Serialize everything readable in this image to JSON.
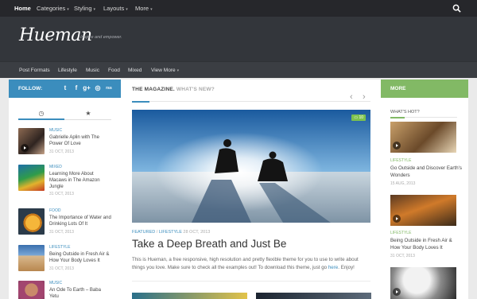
{
  "topnav": {
    "items": [
      {
        "label": "Home"
      },
      {
        "label": "Categories",
        "caret": "▾"
      },
      {
        "label": "Styling",
        "caret": "▾"
      },
      {
        "label": "Layouts",
        "caret": "▾"
      },
      {
        "label": "More",
        "caret": "▾"
      }
    ]
  },
  "header": {
    "logo": "Hueman",
    "tagline": "Inspire and empower."
  },
  "subnav": {
    "items": [
      {
        "label": "Post Formats"
      },
      {
        "label": "Lifestyle"
      },
      {
        "label": "Music"
      },
      {
        "label": "Food"
      },
      {
        "label": "Mixed"
      },
      {
        "label": "View More",
        "caret": "▾"
      }
    ]
  },
  "left": {
    "follow_label": "FOLLOW:",
    "social": [
      "t",
      "f",
      "g+",
      "◎",
      "rss"
    ],
    "tabs": [
      "◷",
      "★"
    ],
    "items": [
      {
        "cat": "MUSIC",
        "title": "Gabrielle Aplin with The Power Of Love",
        "date": "31 OCT, 2013"
      },
      {
        "cat": "MIXED",
        "title": "Learning More About Macaws in The Amazon Jungle",
        "date": "31 OCT, 2013"
      },
      {
        "cat": "FOOD",
        "title": "The Importance of Water and Drinking Lots Of It",
        "date": "31 OCT, 2013"
      },
      {
        "cat": "LIFESTYLE",
        "title": "Being Outside in Fresh Air & How Your Body Loves It",
        "date": "31 OCT, 2013"
      },
      {
        "cat": "MUSIC",
        "title": "An Ode To Earth – Baba Yetu",
        "date": ""
      }
    ]
  },
  "main": {
    "section_title": "THE MAGAZINE.",
    "section_sub": "WHAT'S NEW?",
    "comment_badge": "10",
    "post": {
      "cat1": "FEATURED",
      "sep": " / ",
      "cat2": "LIFESTYLE",
      "date": "28 OCT, 2013",
      "title": "Take a Deep Breath and Just Be",
      "excerpt_a": "This is Hueman, a free responsive, high resolution and pretty flexible theme for you to use to write about things you love. Make sure to check all the examples out! To download this theme, just go",
      "excerpt_link": "here",
      "excerpt_b": ". Enjoy!"
    }
  },
  "right": {
    "more_label": "MORE",
    "hot_label": "WHAT'S HOT?",
    "items": [
      {
        "cat": "LIFESTYLE",
        "title": "Go Outside and Discover Earth's Wonders",
        "date": "15 AUG, 2013"
      },
      {
        "cat": "LIFESTYLE",
        "title": "Being Outside in Fresh Air & How Your Body Loves It",
        "date": "31 OCT, 2013"
      }
    ]
  },
  "colors": {
    "blue": "#3b8dbd",
    "green": "#82b965",
    "dark": "#26272b"
  },
  "icons": [
    "search-icon",
    "twitter-icon",
    "facebook-icon",
    "google-plus-icon",
    "dribbble-icon",
    "rss-icon",
    "clock-icon",
    "star-icon",
    "play-icon",
    "comment-icon"
  ]
}
